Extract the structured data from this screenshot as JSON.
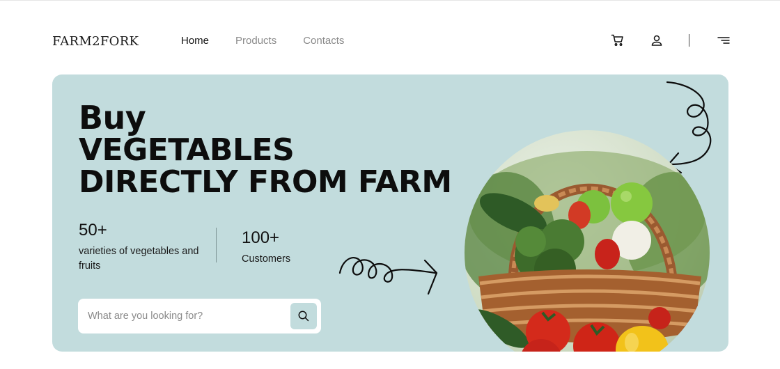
{
  "header": {
    "logo": "FARM2FORK",
    "nav": [
      {
        "label": "Home",
        "active": true
      },
      {
        "label": "Products",
        "active": false
      },
      {
        "label": "Contacts",
        "active": false
      }
    ],
    "icons": [
      "cart-icon",
      "user-icon",
      "menu-icon"
    ]
  },
  "hero": {
    "title_line1": "Buy",
    "title_line2": "VEGETABLES",
    "title_line3": "DIRECTLY FROM FARM",
    "stats": [
      {
        "number": "50+",
        "label": "varieties of vegetables and fruits"
      },
      {
        "number": "100+",
        "label": "Customers"
      }
    ],
    "search": {
      "placeholder": "What are you looking for?",
      "value": ""
    },
    "image_subject": "basket of fresh vegetables",
    "colors": {
      "hero_bg": "#c2dcdd",
      "text": "#0d0d0d",
      "nav_inactive": "#8a8a8a"
    }
  }
}
